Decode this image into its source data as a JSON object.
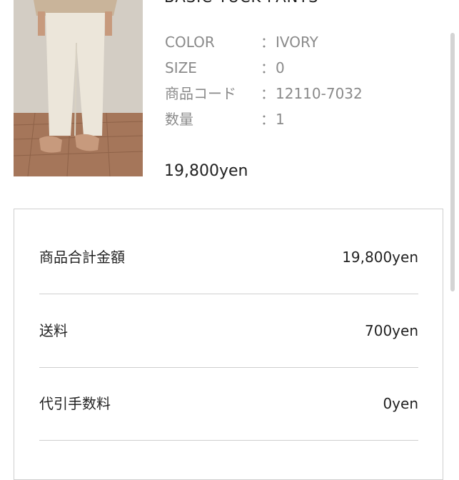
{
  "product": {
    "title": "BASIC TUCK PANTS",
    "specs": [
      {
        "label": "COLOR",
        "sep": "：",
        "value": "IVORY"
      },
      {
        "label": "SIZE",
        "sep": "：",
        "value": "0"
      },
      {
        "label": "商品コード",
        "sep": "：",
        "value": "12110-7032"
      },
      {
        "label": "数量",
        "sep": "：",
        "value": "1"
      }
    ],
    "price": "19,800yen"
  },
  "summary": {
    "rows": [
      {
        "label": "商品合計金額",
        "value": "19,800yen"
      },
      {
        "label": "送料",
        "value": "700yen"
      },
      {
        "label": "代引手数料",
        "value": "0yen"
      }
    ]
  },
  "colors": {
    "text": "#222222",
    "muted": "#8a8a8a",
    "border": "#cfcfcf",
    "floor": "#a5765a",
    "wall": "#cfc9c0",
    "pants": "#ece6da"
  }
}
